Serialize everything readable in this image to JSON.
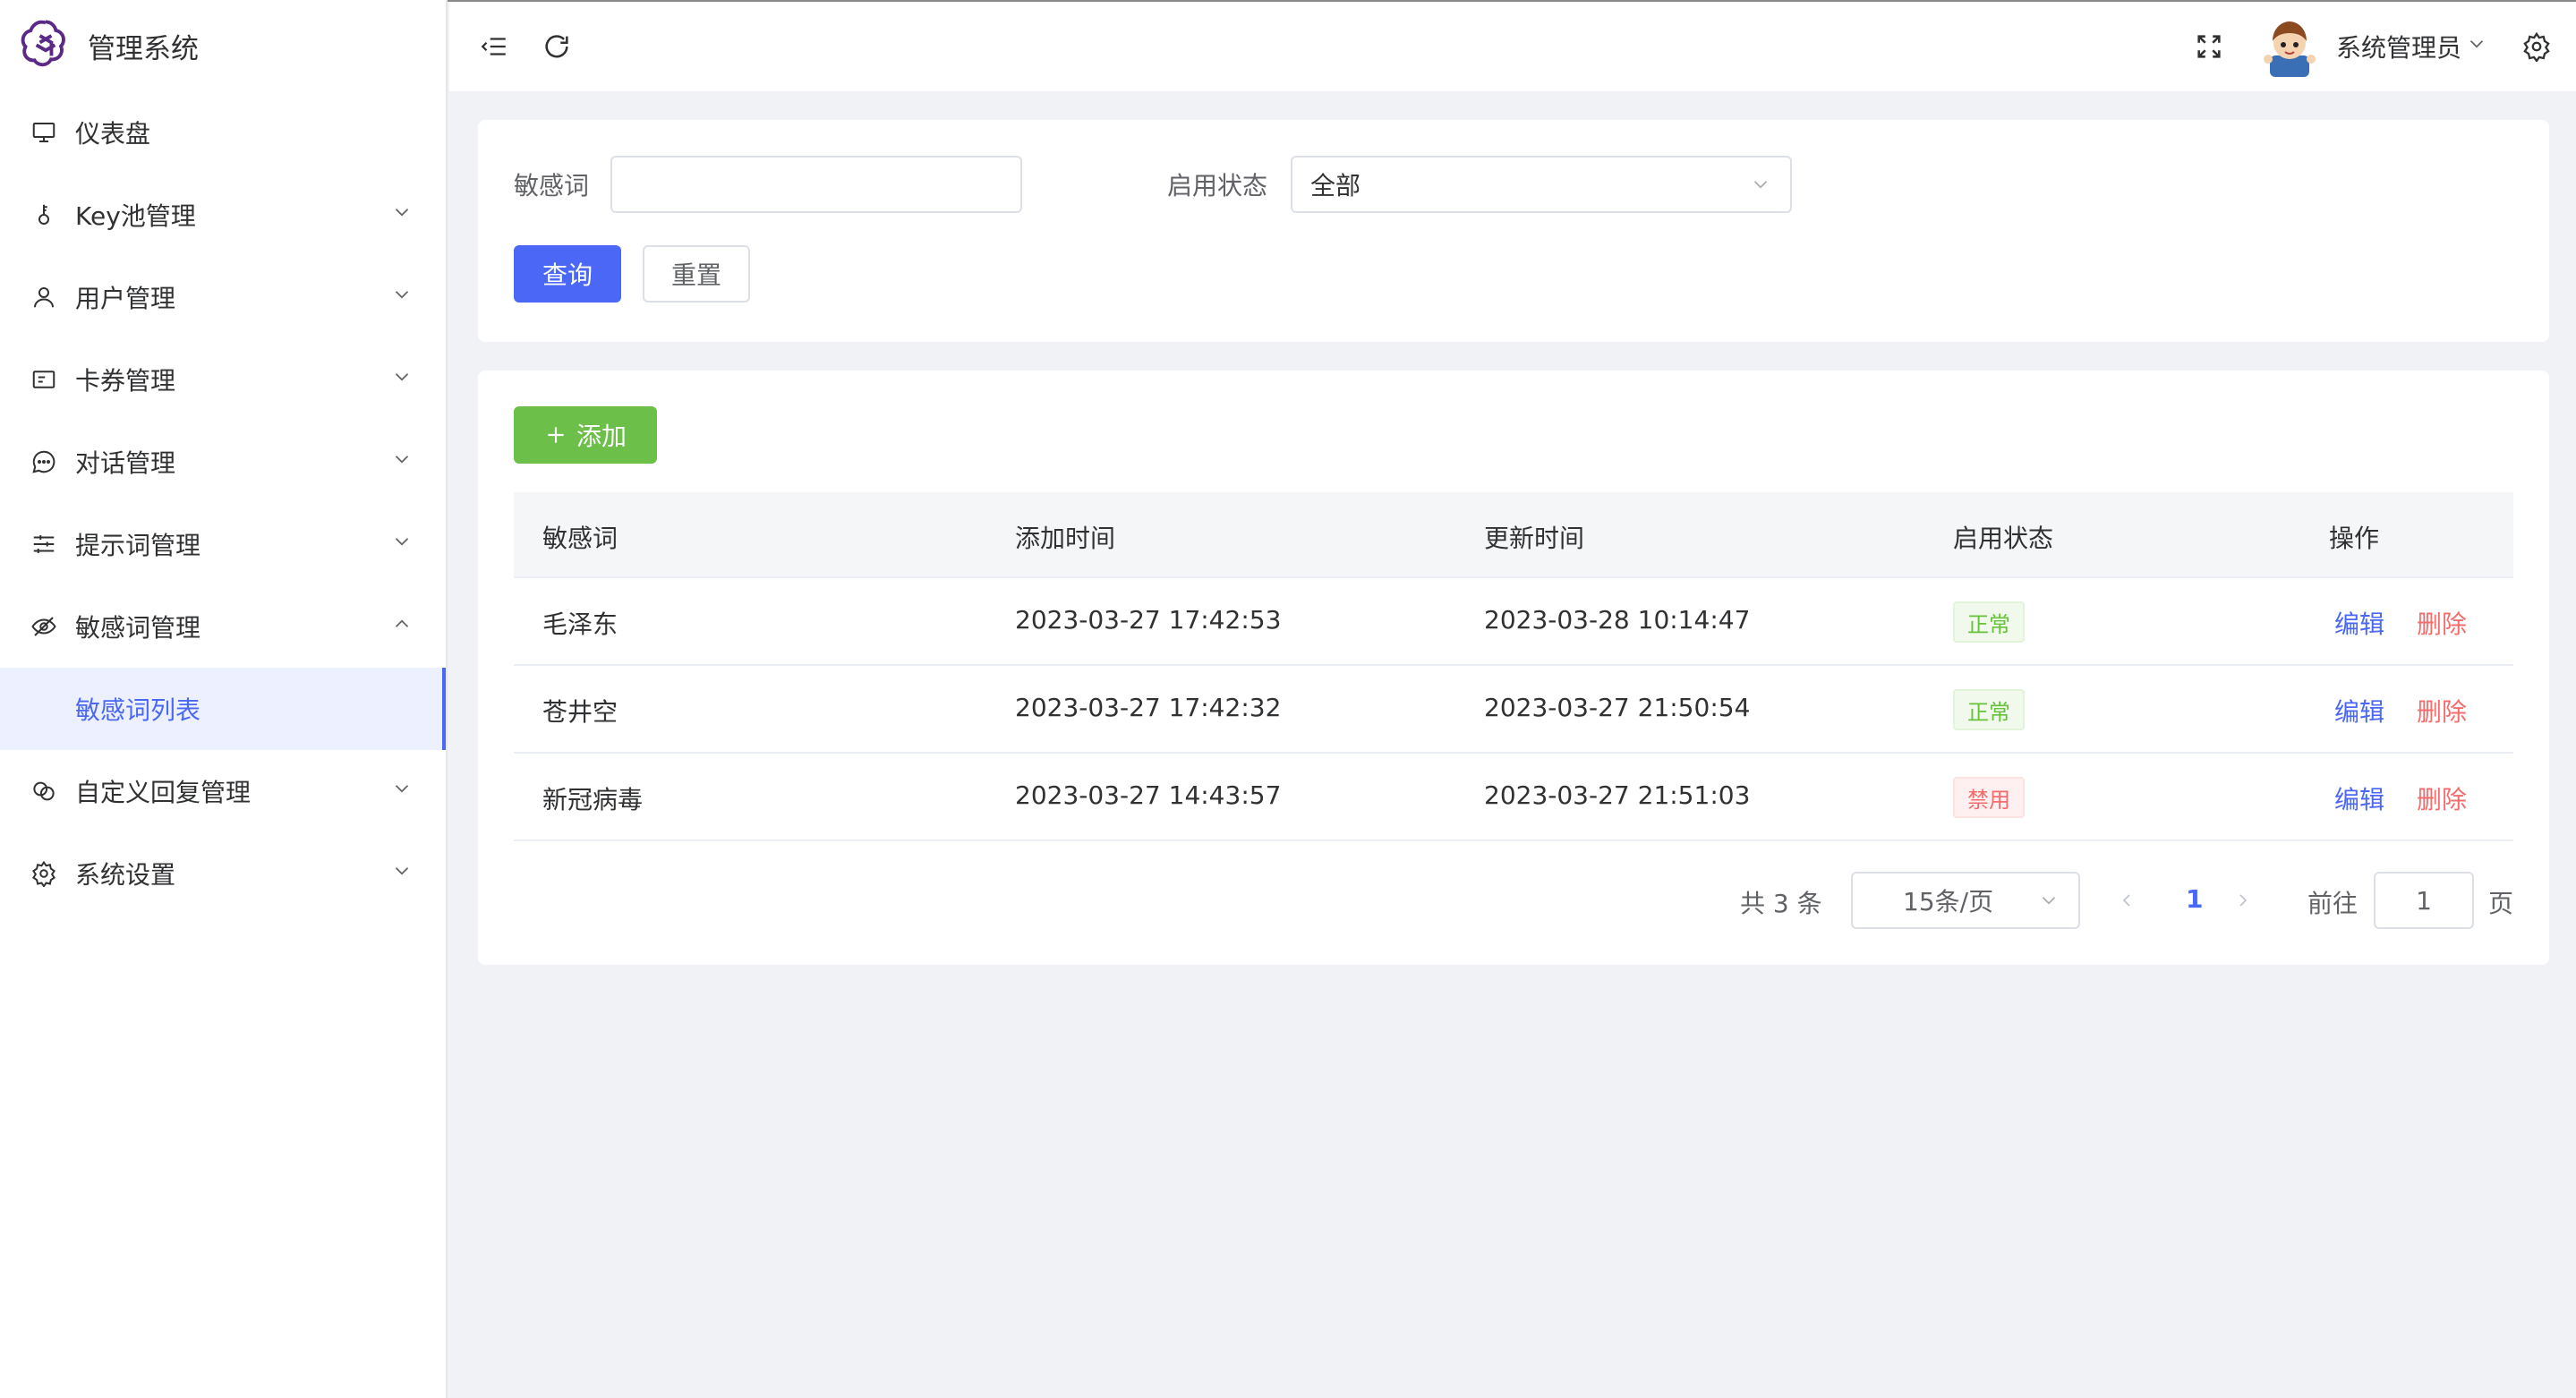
{
  "app": {
    "title": "管理系统"
  },
  "sidebar": {
    "items": [
      {
        "label": "仪表盘",
        "icon": "monitor-icon",
        "has_children": false
      },
      {
        "label": "Key池管理",
        "icon": "key-icon",
        "has_children": true
      },
      {
        "label": "用户管理",
        "icon": "user-icon",
        "has_children": true
      },
      {
        "label": "卡券管理",
        "icon": "card-icon",
        "has_children": true
      },
      {
        "label": "对话管理",
        "icon": "chat-icon",
        "has_children": true
      },
      {
        "label": "提示词管理",
        "icon": "sliders-icon",
        "has_children": true
      },
      {
        "label": "敏感词管理",
        "icon": "eye-off-icon",
        "has_children": true,
        "expanded": true
      },
      {
        "label": "敏感词列表",
        "active": true
      },
      {
        "label": "自定义回复管理",
        "icon": "reply-icon",
        "has_children": true
      },
      {
        "label": "系统设置",
        "icon": "gear-icon",
        "has_children": true
      }
    ]
  },
  "header": {
    "user_name": "系统管理员"
  },
  "search": {
    "word_label": "敏感词",
    "word_value": "",
    "word_placeholder": "",
    "status_label": "启用状态",
    "status_value": "全部",
    "query_button": "查询",
    "reset_button": "重置"
  },
  "toolbar": {
    "add_button": "添加"
  },
  "table": {
    "columns": [
      "敏感词",
      "添加时间",
      "更新时间",
      "启用状态",
      "操作"
    ],
    "rows": [
      {
        "word": "毛泽东",
        "created": "2023-03-27 17:42:53",
        "updated": "2023-03-28 10:14:47",
        "status": "正常",
        "status_type": "ok",
        "edit": "编辑",
        "delete": "删除"
      },
      {
        "word": "苍井空",
        "created": "2023-03-27 17:42:32",
        "updated": "2023-03-27 21:50:54",
        "status": "正常",
        "status_type": "ok",
        "edit": "编辑",
        "delete": "删除"
      },
      {
        "word": "新冠病毒",
        "created": "2023-03-27 14:43:57",
        "updated": "2023-03-27 21:51:03",
        "status": "禁用",
        "status_type": "no",
        "edit": "编辑",
        "delete": "删除"
      }
    ]
  },
  "pagination": {
    "total_text": "共 3 条",
    "page_size": "15条/页",
    "current_page": "1",
    "goto_label": "前往",
    "goto_value": "1",
    "page_suffix": "页"
  },
  "colors": {
    "primary": "#4a67f5",
    "success": "#6cc04a",
    "danger": "#f56c6c",
    "background": "#f0f2f5"
  }
}
